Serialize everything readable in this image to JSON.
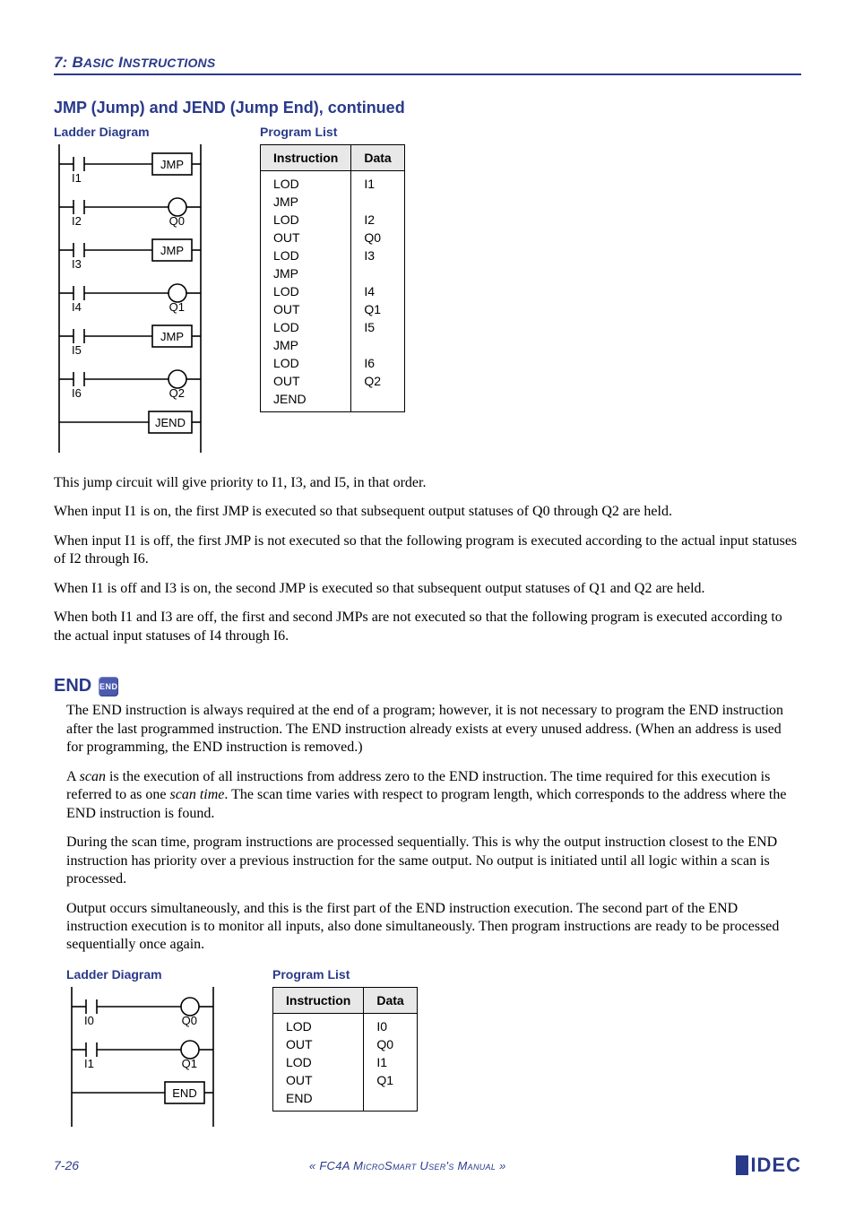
{
  "header": {
    "chapter": "7:",
    "title_first": "B",
    "title_rest1": "ASIC",
    "title_space": " ",
    "title_first2": "I",
    "title_rest2": "NSTRUCTIONS"
  },
  "section1": {
    "title": "JMP (Jump) and JEND (Jump End), continued",
    "ladder_label": "Ladder Diagram",
    "program_label": "Program List",
    "ladder": {
      "blocks": [
        "JMP",
        "JMP",
        "JMP",
        "JEND"
      ],
      "contacts": [
        "I1",
        "I2",
        "I3",
        "I4",
        "I5",
        "I6"
      ],
      "coils": [
        "Q0",
        "Q1",
        "Q2"
      ]
    },
    "program_list": {
      "headers": [
        "Instruction",
        "Data"
      ],
      "rows": [
        {
          "instr": "LOD",
          "data": "I1"
        },
        {
          "instr": "JMP",
          "data": ""
        },
        {
          "instr": "LOD",
          "data": "I2"
        },
        {
          "instr": "OUT",
          "data": "Q0"
        },
        {
          "instr": "LOD",
          "data": "I3"
        },
        {
          "instr": "JMP",
          "data": ""
        },
        {
          "instr": "LOD",
          "data": "I4"
        },
        {
          "instr": "OUT",
          "data": "Q1"
        },
        {
          "instr": "LOD",
          "data": "I5"
        },
        {
          "instr": "JMP",
          "data": ""
        },
        {
          "instr": "LOD",
          "data": "I6"
        },
        {
          "instr": "OUT",
          "data": "Q2"
        },
        {
          "instr": "JEND",
          "data": ""
        }
      ]
    },
    "paragraphs": [
      "This jump circuit will give priority to I1, I3, and I5, in that order.",
      "When input I1 is on, the first JMP is executed so that subsequent output statuses of Q0 through Q2 are held.",
      "When input I1 is off, the first JMP is not executed so that the following program is executed according to the actual input statuses of I2 through I6.",
      "When I1 is off and I3 is on, the second JMP is executed so that subsequent output statuses of Q1 and Q2 are held.",
      "When both I1 and I3 are off, the first and second JMPs are not executed so that the following program is executed according to the actual input statuses of I4 through I6."
    ]
  },
  "section2": {
    "title": "END",
    "icon_text": "END",
    "paragraphs_a": [
      "The END instruction is always required at the end of a program; however, it is not necessary to program the END instruction after the last programmed instruction. The END instruction already exists at every unused address. (When an address is used for programming, the END instruction is removed.)"
    ],
    "scan_para_prefix": "A ",
    "scan_word": "scan",
    "scan_para_mid": " is the execution of all instructions from address zero to the END instruction. The time required for this execution is referred to as one ",
    "scan_time_word": "scan time",
    "scan_para_suffix": ". The scan time varies with respect to program length, which corresponds to the address where the END instruction is found.",
    "paragraphs_b": [
      "During the scan time, program instructions are processed sequentially. This is why the output instruction closest to the END instruction has priority over a previous instruction for the same output. No output is initiated until all logic within a scan is processed.",
      "Output occurs simultaneously, and this is the first part of the END instruction execution. The second part of the END instruction execution is to monitor all inputs, also done simultaneously. Then program instructions are ready to be processed sequentially once again."
    ],
    "ladder_label": "Ladder Diagram",
    "program_label": "Program List",
    "ladder": {
      "blocks": [
        "END"
      ],
      "contacts": [
        "I0",
        "I1"
      ],
      "coils": [
        "Q0",
        "Q1"
      ]
    },
    "program_list": {
      "headers": [
        "Instruction",
        "Data"
      ],
      "rows": [
        {
          "instr": "LOD",
          "data": "I0"
        },
        {
          "instr": "OUT",
          "data": "Q0"
        },
        {
          "instr": "LOD",
          "data": "I1"
        },
        {
          "instr": "OUT",
          "data": "Q1"
        },
        {
          "instr": "END",
          "data": ""
        }
      ]
    }
  },
  "footer": {
    "page": "7-26",
    "manual": "« FC4A MicroSmart User's Manual »",
    "logo": "IDEC"
  }
}
